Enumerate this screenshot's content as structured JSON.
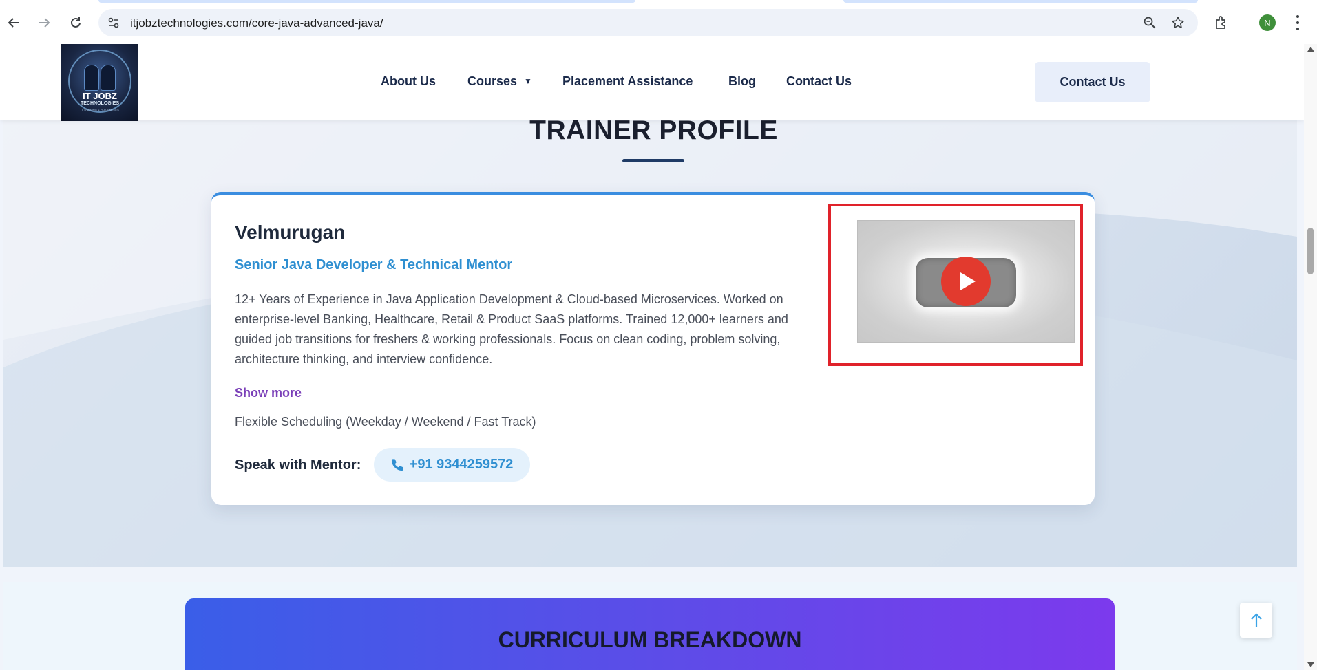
{
  "browser": {
    "url": "itjobztechnologies.com/core-java-advanced-java/",
    "profile_initial": "N"
  },
  "header": {
    "logo_text": "IT JOBZ",
    "logo_subtext": "TECHNOLOGIES",
    "logo_tagline": "IT TRAINING & PLACEMENTS",
    "nav": {
      "about": "About Us",
      "courses": "Courses",
      "courses_caret": "▼",
      "placement": "Placement Assistance",
      "blog": "Blog",
      "contact": "Contact Us"
    },
    "cta_label": "Contact Us"
  },
  "trainer": {
    "section_title": "TRAINER PROFILE",
    "name": "Velmurugan",
    "role": "Senior Java Developer & Technical Mentor",
    "bio": "12+ Years of Experience in Java Application Development & Cloud-based Microservices. Worked on enterprise-level Banking, Healthcare, Retail & Product SaaS platforms. Trained 12,000+ learners and guided job transitions for freshers & working professionals. Focus on clean coding, problem solving, architecture thinking, and interview confidence.",
    "show_more": "Show more",
    "schedule": "Flexible Scheduling (Weekday / Weekend / Fast Track)",
    "speak_label": "Speak with Mentor:",
    "phone": "+91 9344259572",
    "video_icon": "play-icon"
  },
  "curriculum": {
    "title": "CURRICULUM BREAKDOWN"
  },
  "colors": {
    "accent_blue": "#2f8fd1",
    "show_more_purple": "#7a3fb8",
    "highlight_red": "#e0222a",
    "play_red": "#e23a2e",
    "header_cta_bg": "#e8eefa"
  }
}
